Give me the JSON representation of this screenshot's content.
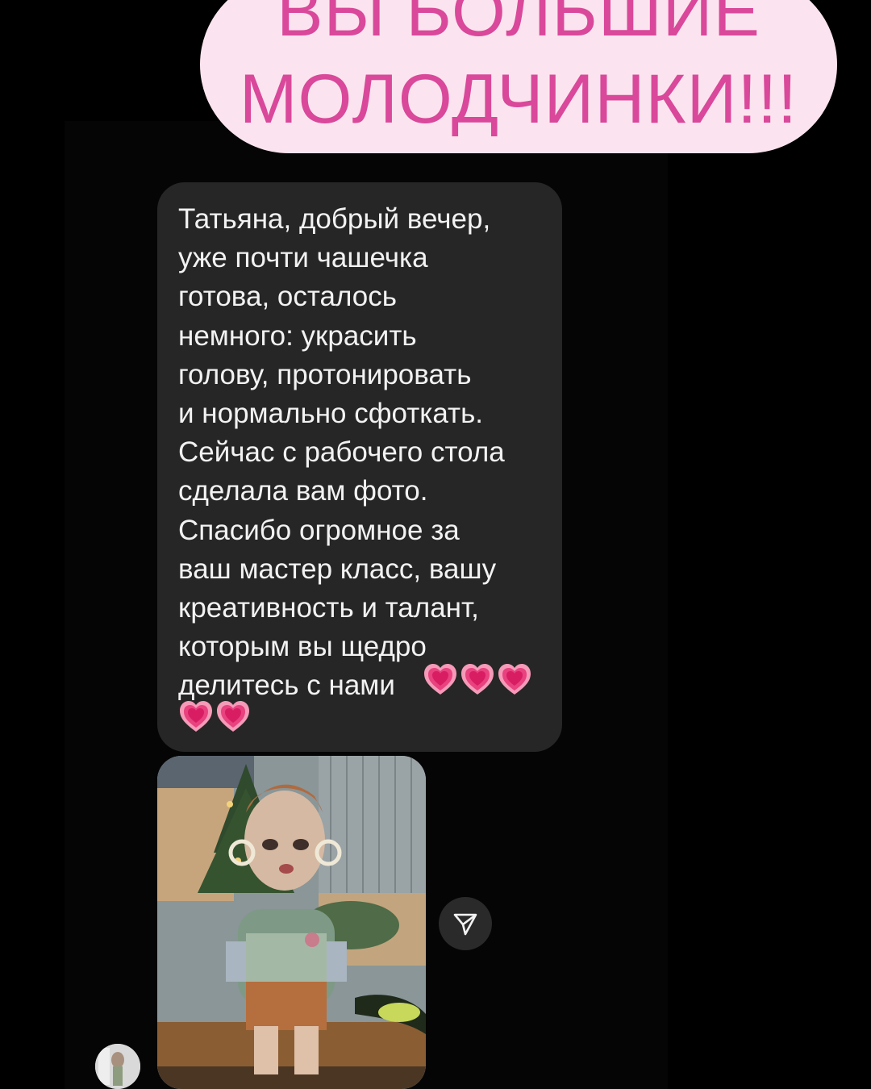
{
  "banner": {
    "line1": "ВЫ БОЛЬШИЕ",
    "line2": "МОЛОДЧИНКИ!!!"
  },
  "message": {
    "text": "Татьяна, добрый вечер,\nуже почти чашечка\nготова, осталось\nнемного: украсить\nголову, протонировать\nи нормально сфоткать.\nСейчас с рабочего стола\nсделала вам фото.\nСпасибо огромное за\nваш мастер класс, вашу\nкреативность и талант,\nкоторым вы щедро\nделитесь с нами",
    "emoji": [
      "growing-heart-icon",
      "growing-heart-icon",
      "growing-heart-icon",
      "growing-heart-icon",
      "growing-heart-icon"
    ]
  },
  "photo": {
    "subject": "doll-photo"
  },
  "icons": {
    "share": "paper-plane-icon",
    "avatar": "user-avatar"
  },
  "colors": {
    "banner_bg": "#fbe4ef",
    "banner_text": "#d9489a",
    "bubble_bg": "#262626",
    "heart": "#e8427f"
  }
}
